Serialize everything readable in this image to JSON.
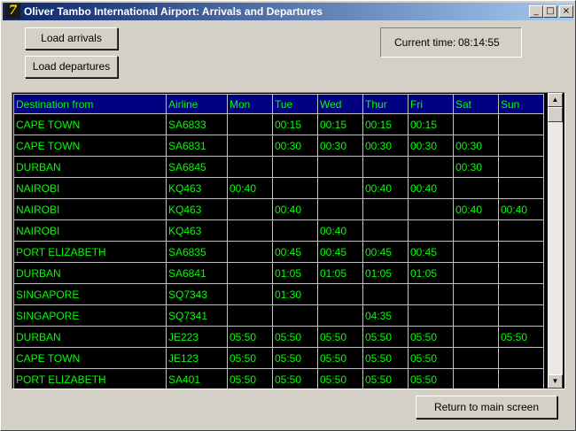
{
  "window": {
    "title": "Oliver Tambo International Airport: Arrivals and Departures",
    "icon": "7"
  },
  "title_buttons": {
    "minimize": "_",
    "maximize": "□",
    "close": "×"
  },
  "buttons": {
    "load_arrivals": "Load arrivals",
    "load_departures": "Load departures",
    "return": "Return to main screen"
  },
  "clock": {
    "label": "Current time:",
    "value": "08:14:55"
  },
  "grid": {
    "columns": [
      "Destination from",
      "Airline",
      "Mon",
      "Tue",
      "Wed",
      "Thur",
      "Fri",
      "Sat",
      "Sun"
    ],
    "rows": [
      [
        "CAPE TOWN",
        "SA6833",
        "",
        "00:15",
        "00:15",
        "00:15",
        "00:15",
        "",
        ""
      ],
      [
        "CAPE TOWN",
        "SA6831",
        "",
        "00:30",
        "00:30",
        "00:30",
        "00:30",
        "00:30",
        ""
      ],
      [
        "DURBAN",
        "SA6845",
        "",
        "",
        "",
        "",
        "",
        "00:30",
        ""
      ],
      [
        "NAIROBI",
        "KQ463",
        "00:40",
        "",
        "",
        "00:40",
        "00:40",
        "",
        ""
      ],
      [
        "NAIROBI",
        "KQ463",
        "",
        "00:40",
        "",
        "",
        "",
        "00:40",
        "00:40"
      ],
      [
        "NAIROBI",
        "KQ463",
        "",
        "",
        "00:40",
        "",
        "",
        "",
        ""
      ],
      [
        "PORT ELIZABETH",
        "SA6835",
        "",
        "00:45",
        "00:45",
        "00:45",
        "00:45",
        "",
        ""
      ],
      [
        "DURBAN",
        "SA6841",
        "",
        "01:05",
        "01:05",
        "01:05",
        "01:05",
        "",
        ""
      ],
      [
        "SINGAPORE",
        "SQ7343",
        "",
        "01:30",
        "",
        "",
        "",
        "",
        ""
      ],
      [
        "SINGAPORE",
        "SQ7341",
        "",
        "",
        "",
        "04:35",
        "",
        "",
        ""
      ],
      [
        "DURBAN",
        "JE223",
        "05:50",
        "05:50",
        "05:50",
        "05:50",
        "05:50",
        "",
        "05:50"
      ],
      [
        "CAPE TOWN",
        "JE123",
        "05:50",
        "05:50",
        "05:50",
        "05:50",
        "05:50",
        "",
        ""
      ],
      [
        "PORT ELIZABETH",
        "SA401",
        "05:50",
        "05:50",
        "05:50",
        "05:50",
        "05:50",
        "",
        ""
      ]
    ]
  },
  "scrollbar": {
    "up": "▲",
    "down": "▼"
  },
  "colors": {
    "title_start": "#0a246a",
    "title_end": "#a6caf0",
    "grid_bg": "#000000",
    "grid_text": "#00ff00",
    "header_bg": "#000080"
  }
}
